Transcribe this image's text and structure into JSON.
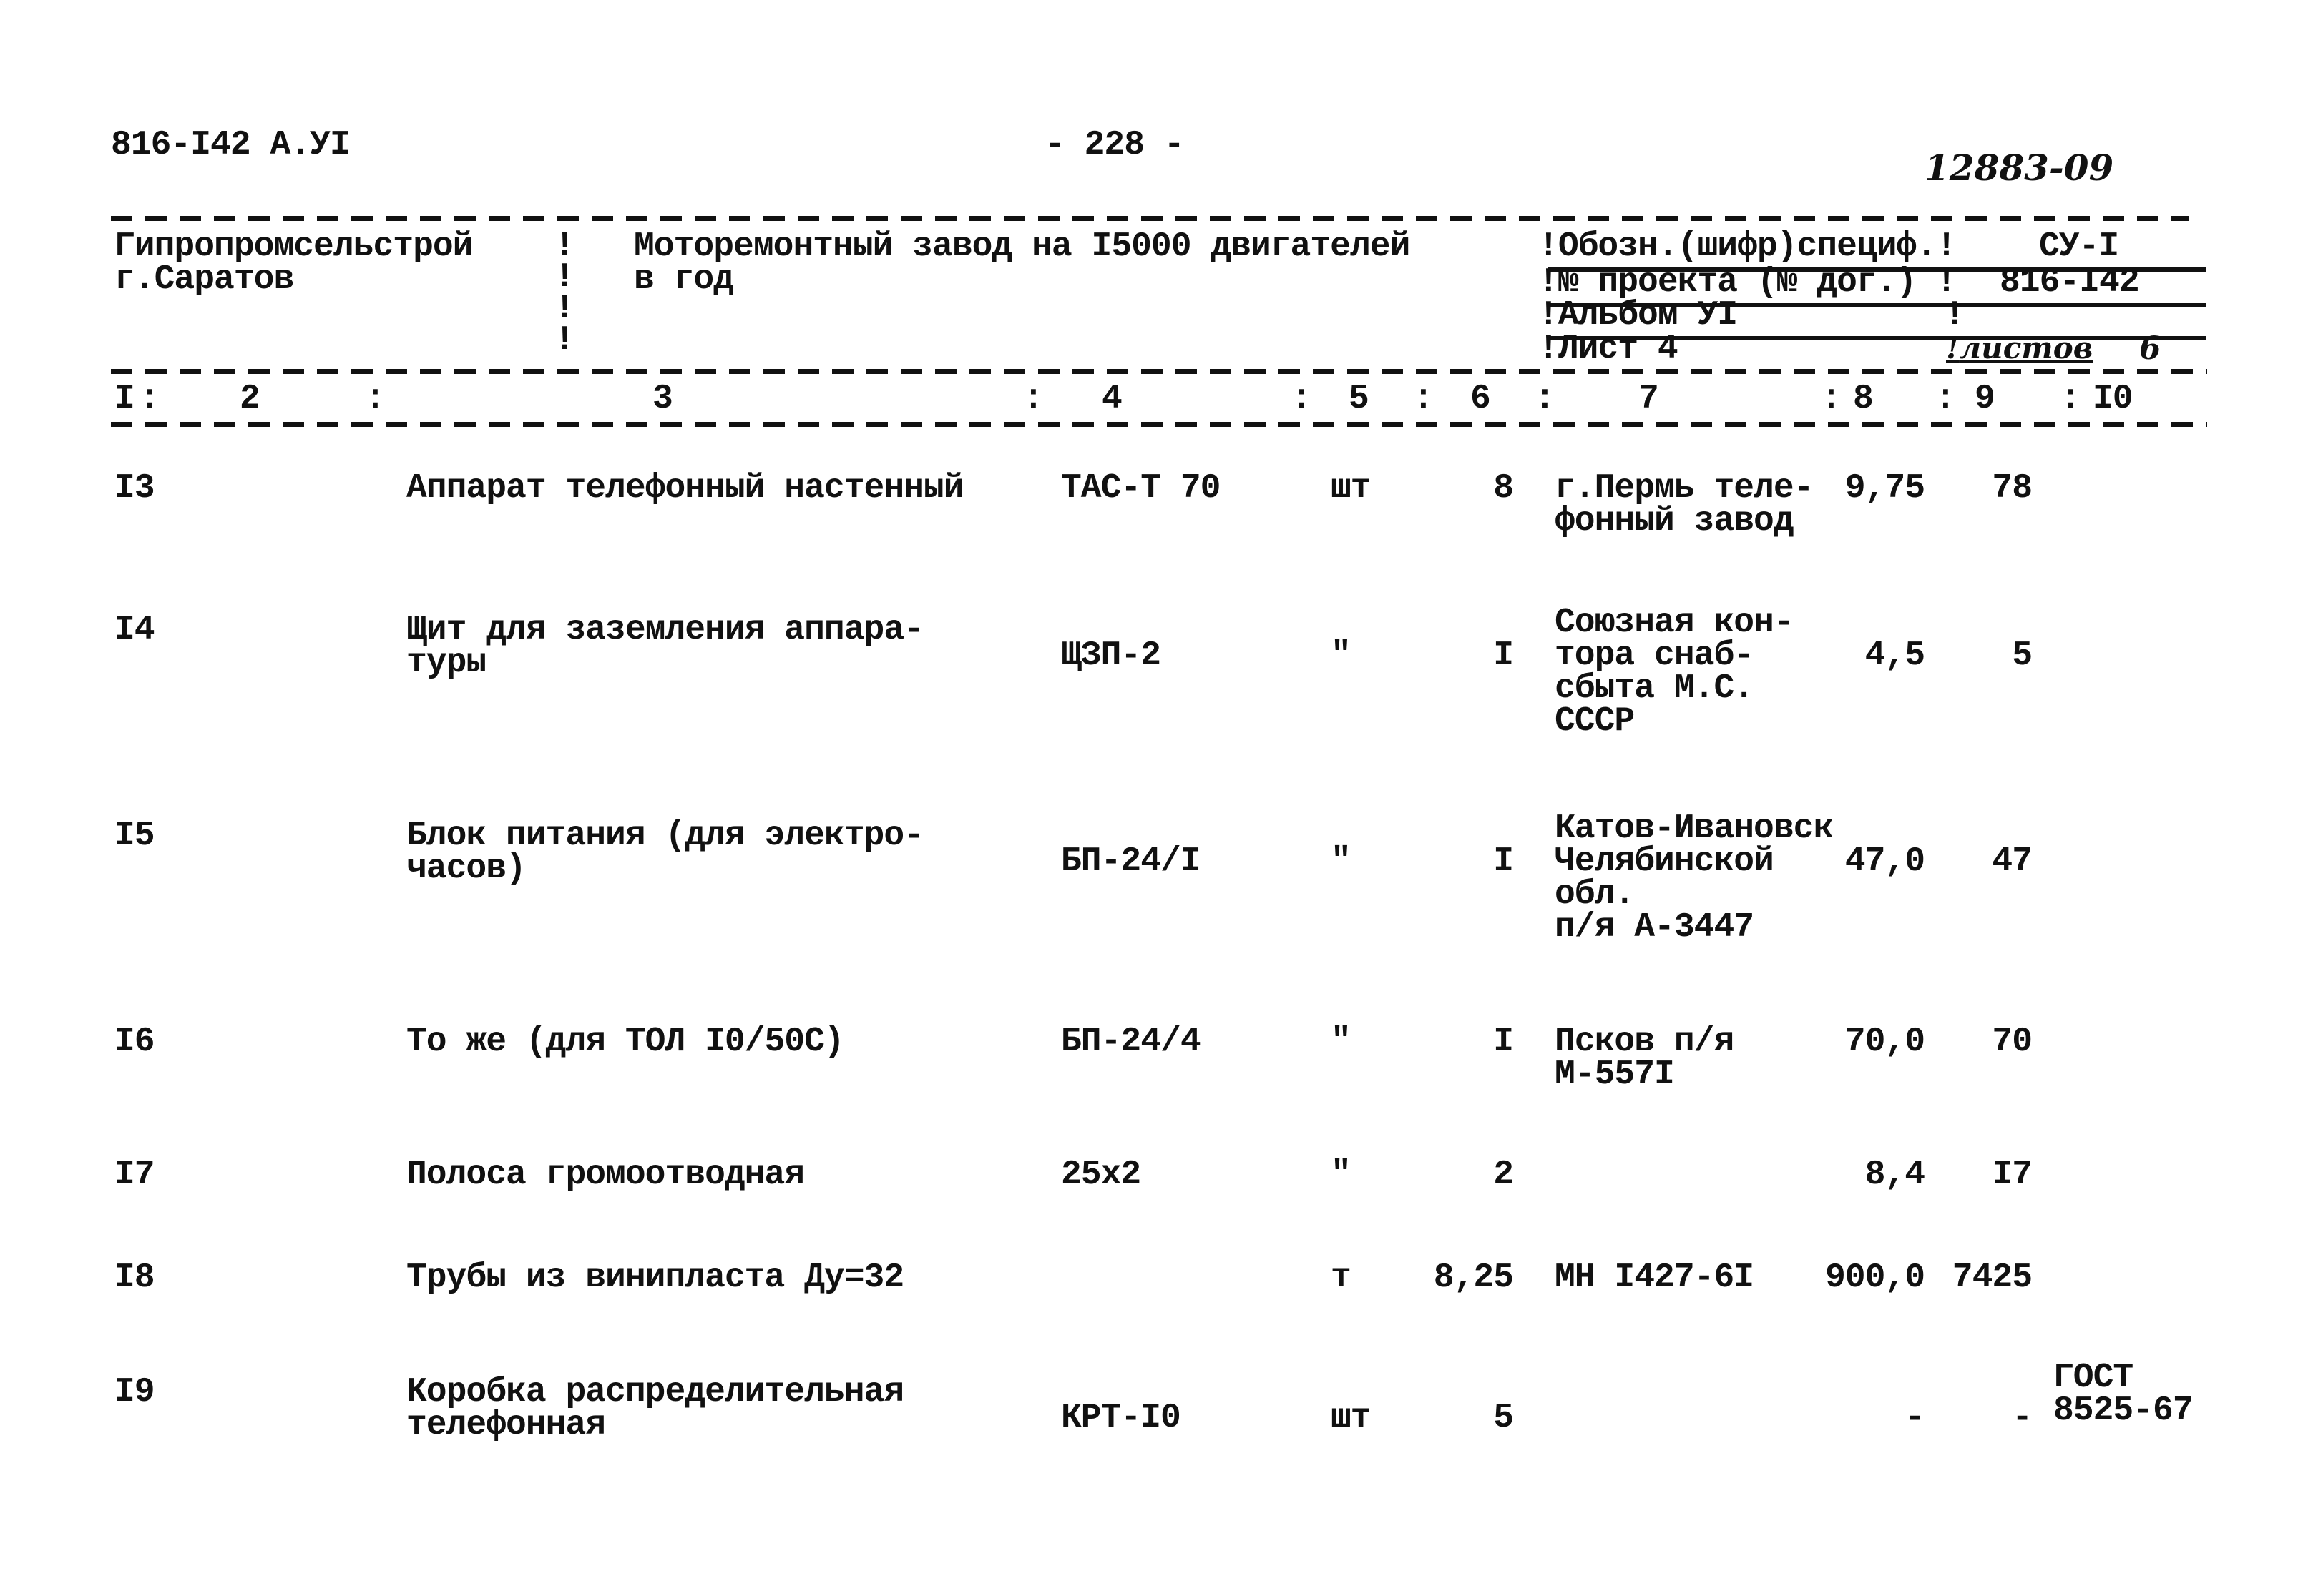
{
  "header": {
    "doc_code": "816-I42 А.УI",
    "page_number": "- 228 -",
    "handwritten_number": "12883-09"
  },
  "stamp": {
    "organization": "Гипропромсельстрой\n   г.Саратов",
    "project_title": "Моторемонтный завод на I5000 двигателей\n             в год",
    "spec_label": "Обозн.(шифр)специф.",
    "spec_value": "СУ-I",
    "project_no_label": "№ проекта (№ дог.)",
    "project_no_value": "816-I42",
    "album_label": "Альбом УI",
    "sheet_label": "Лист 4",
    "sheets_label": "листов",
    "sheets_value": "6"
  },
  "columns": [
    "I",
    "2",
    "3",
    "4",
    "5",
    "6",
    "7",
    "8",
    "9",
    "I0"
  ],
  "rows": [
    {
      "num": "I3",
      "name": "Аппарат телефонный настенный",
      "type": "ТАС-Т 70",
      "unit": "шт",
      "qty": "8",
      "supplier": "г.Пермь теле-\nфонный завод",
      "price": "9,75",
      "total": "78",
      "note": ""
    },
    {
      "num": "I4",
      "name": "Щит для заземления аппара-\nтуры",
      "type": "ЩЗП-2",
      "unit": "\"",
      "qty": "I",
      "supplier": "Союзная кон-\nтора снаб-\nсбыта М.С.\nСССР",
      "price": "4,5",
      "total": "5",
      "note": ""
    },
    {
      "num": "I5",
      "name": "Блок питания (для электро-\nчасов)",
      "type": "БП-24/I",
      "unit": "\"",
      "qty": "I",
      "supplier": "Катов-Ивановск\nЧелябинской\nобл.\nп/я А-3447",
      "price": "47,0",
      "total": "47",
      "note": ""
    },
    {
      "num": "I6",
      "name": "То же (для ТОЛ I0/50С)",
      "type": "БП-24/4",
      "unit": "\"",
      "qty": "I",
      "supplier": "Псков п/я\nМ-557I",
      "price": "70,0",
      "total": "70",
      "note": ""
    },
    {
      "num": "I7",
      "name": "Полоса громоотводная",
      "type": "25х2",
      "unit": "\"",
      "qty": "2",
      "supplier": "",
      "price": "8,4",
      "total": "I7",
      "note": ""
    },
    {
      "num": "I8",
      "name": "Трубы из винипласта Ду=32",
      "type": "",
      "unit": "т",
      "qty": "8,25",
      "supplier": "МН I427-6I",
      "price": "900,0",
      "total": "7425",
      "note": ""
    },
    {
      "num": "I9",
      "name": "Коробка распределительная\nтелефонная",
      "type": "КРТ-I0",
      "unit": "шт",
      "qty": "5",
      "supplier": "",
      "price": "-",
      "total": "-",
      "note": "ГОСТ\n8525-67"
    }
  ]
}
